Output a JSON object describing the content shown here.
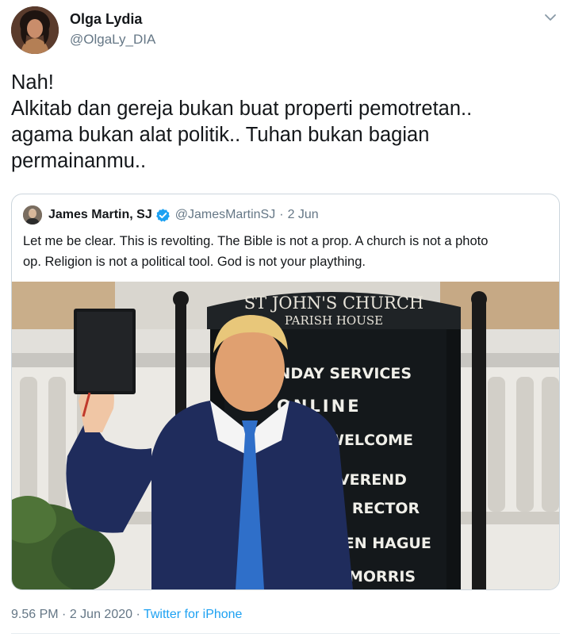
{
  "author": {
    "name": "Olga Lydia",
    "handle": "@OlgaLy_DIA"
  },
  "tweet": {
    "lines": [
      "Nah!",
      "Alkitab dan gereja bukan buat properti pemotretan..",
      "agama bukan alat politik.. Tuhan bukan bagian",
      "permainanmu.."
    ]
  },
  "quoted": {
    "name": "James Martin, SJ",
    "handle": "@JamesMartinSJ",
    "separator": "·",
    "date": "2 Jun",
    "lines": [
      "Let me be clear. This is revolting. The Bible is not a prop. A church is not a photo",
      "op. Religion is not a political tool. God is not your plaything."
    ],
    "photo": {
      "sign_title_1": "ST JOHN'S CHURCH",
      "sign_title_2": "PARISH HOUSE",
      "sign_lines": [
        "UNDAY SERVICES",
        "ONLINE",
        "WELCOME",
        "EVEREND",
        "R. RECTOR",
        "KEN HAGUE",
        "MORRIS"
      ]
    }
  },
  "footer": {
    "time": "9.56 PM",
    "separator": "·",
    "date": "2 Jun 2020",
    "source": "Twitter for iPhone"
  },
  "colors": {
    "text": "#14171a",
    "secondary": "#657786",
    "link": "#1da1f2",
    "border": "#ccd6dd"
  },
  "icons": [
    "caret-down-icon",
    "verified-badge-icon"
  ]
}
